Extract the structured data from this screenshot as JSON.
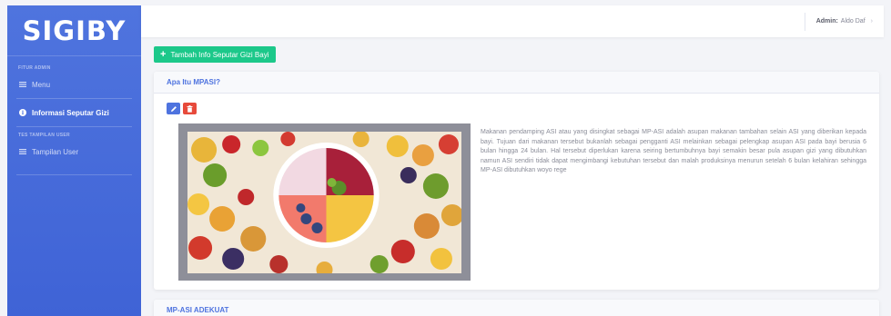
{
  "sidebar": {
    "brand": "SIGIBY",
    "sections": [
      {
        "label": "FITUR ADMIN",
        "items": [
          {
            "label": "Menu",
            "icon": "list-icon",
            "active": false
          },
          {
            "label": "Informasi Seputar Gizi",
            "icon": "info-circle-icon",
            "active": true
          }
        ]
      },
      {
        "label": "TES TAMPILAN USER",
        "items": [
          {
            "label": "Tampilan User",
            "icon": "list-icon",
            "active": false
          }
        ]
      }
    ]
  },
  "topbar": {
    "user_prefix": "Admin:",
    "user_name": "Aldo Daf"
  },
  "main": {
    "add_button_label": "Tambah Info Seputar Gizi Bayi",
    "cards": [
      {
        "title": "Apa Itu MPASI?",
        "description": "Makanan pendamping ASI atau yang disingkat sebagai MP-ASI adalah asupan makanan tambahan selain ASI yang diberikan kepada bayi. Tujuan dari makanan tersebut bukanlah sebagai pengganti ASI melainkan sebagai pelengkap asupan ASI pada bayi berusia 6 bulan hingga 24 bulan. Hal tersebut diperlukan karena seiring bertumbuhnya bayi semakin besar pula asupan gizi yang dibutuhkan namun ASI sendiri tidak dapat mengimbangi kebutuhan tersebut dan malah produksinya menurun setelah 6 bulan kelahiran sehingga MP-ASI dibutuhkan woyo rege"
      },
      {
        "title": "MP-ASI ADEKUAT"
      }
    ]
  },
  "colors": {
    "primary": "#4e73df",
    "success": "#1cc88a",
    "danger": "#e74a3b",
    "sidebar": "#4e73df"
  }
}
